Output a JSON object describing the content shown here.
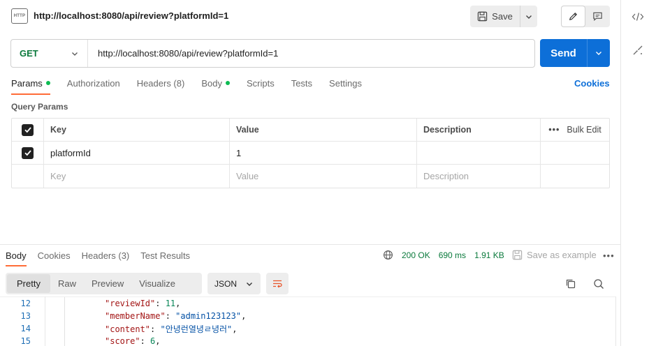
{
  "header": {
    "badge_text": "HTTP",
    "title": "http://localhost:8080/api/review?platformId=1",
    "save_label": "Save"
  },
  "request": {
    "method": "GET",
    "url": "http://localhost:8080/api/review?platformId=1",
    "send_label": "Send",
    "tabs": [
      {
        "label": "Params",
        "active": true,
        "dot": true
      },
      {
        "label": "Authorization"
      },
      {
        "label": "Headers (8)"
      },
      {
        "label": "Body",
        "dot": true
      },
      {
        "label": "Scripts"
      },
      {
        "label": "Tests"
      },
      {
        "label": "Settings"
      }
    ],
    "cookies_label": "Cookies"
  },
  "params": {
    "section_label": "Query Params",
    "columns": {
      "key": "Key",
      "value": "Value",
      "description": "Description",
      "bulk_edit": "Bulk Edit"
    },
    "rows": [
      {
        "key": "platformId",
        "value": "1",
        "description": "",
        "checked": true
      }
    ],
    "placeholder": {
      "key": "Key",
      "value": "Value",
      "description": "Description"
    }
  },
  "response": {
    "tabs": [
      "Body",
      "Cookies",
      "Headers (3)",
      "Test Results"
    ],
    "status": "200 OK",
    "time": "690 ms",
    "size": "1.91 KB",
    "save_example": "Save as example",
    "more": "•••",
    "view_tabs": [
      "Pretty",
      "Raw",
      "Preview",
      "Visualize"
    ],
    "format": "JSON",
    "lines": [
      {
        "num": "12",
        "key": "\"reviewId\"",
        "val": "11",
        "type": "num"
      },
      {
        "num": "13",
        "key": "\"memberName\"",
        "val": "\"admin123123\"",
        "type": "str"
      },
      {
        "num": "14",
        "key": "\"content\"",
        "val": "\"안녕런열녕ㄹ녕러\"",
        "type": "str"
      },
      {
        "num": "15",
        "key": "\"score\"",
        "val": "6",
        "type": "num"
      }
    ]
  },
  "colors": {
    "accent_orange": "#ff6c37",
    "send_blue": "#0d6fd8",
    "get_green": "#0b7a3c",
    "status_green": "#0b7a3c"
  }
}
